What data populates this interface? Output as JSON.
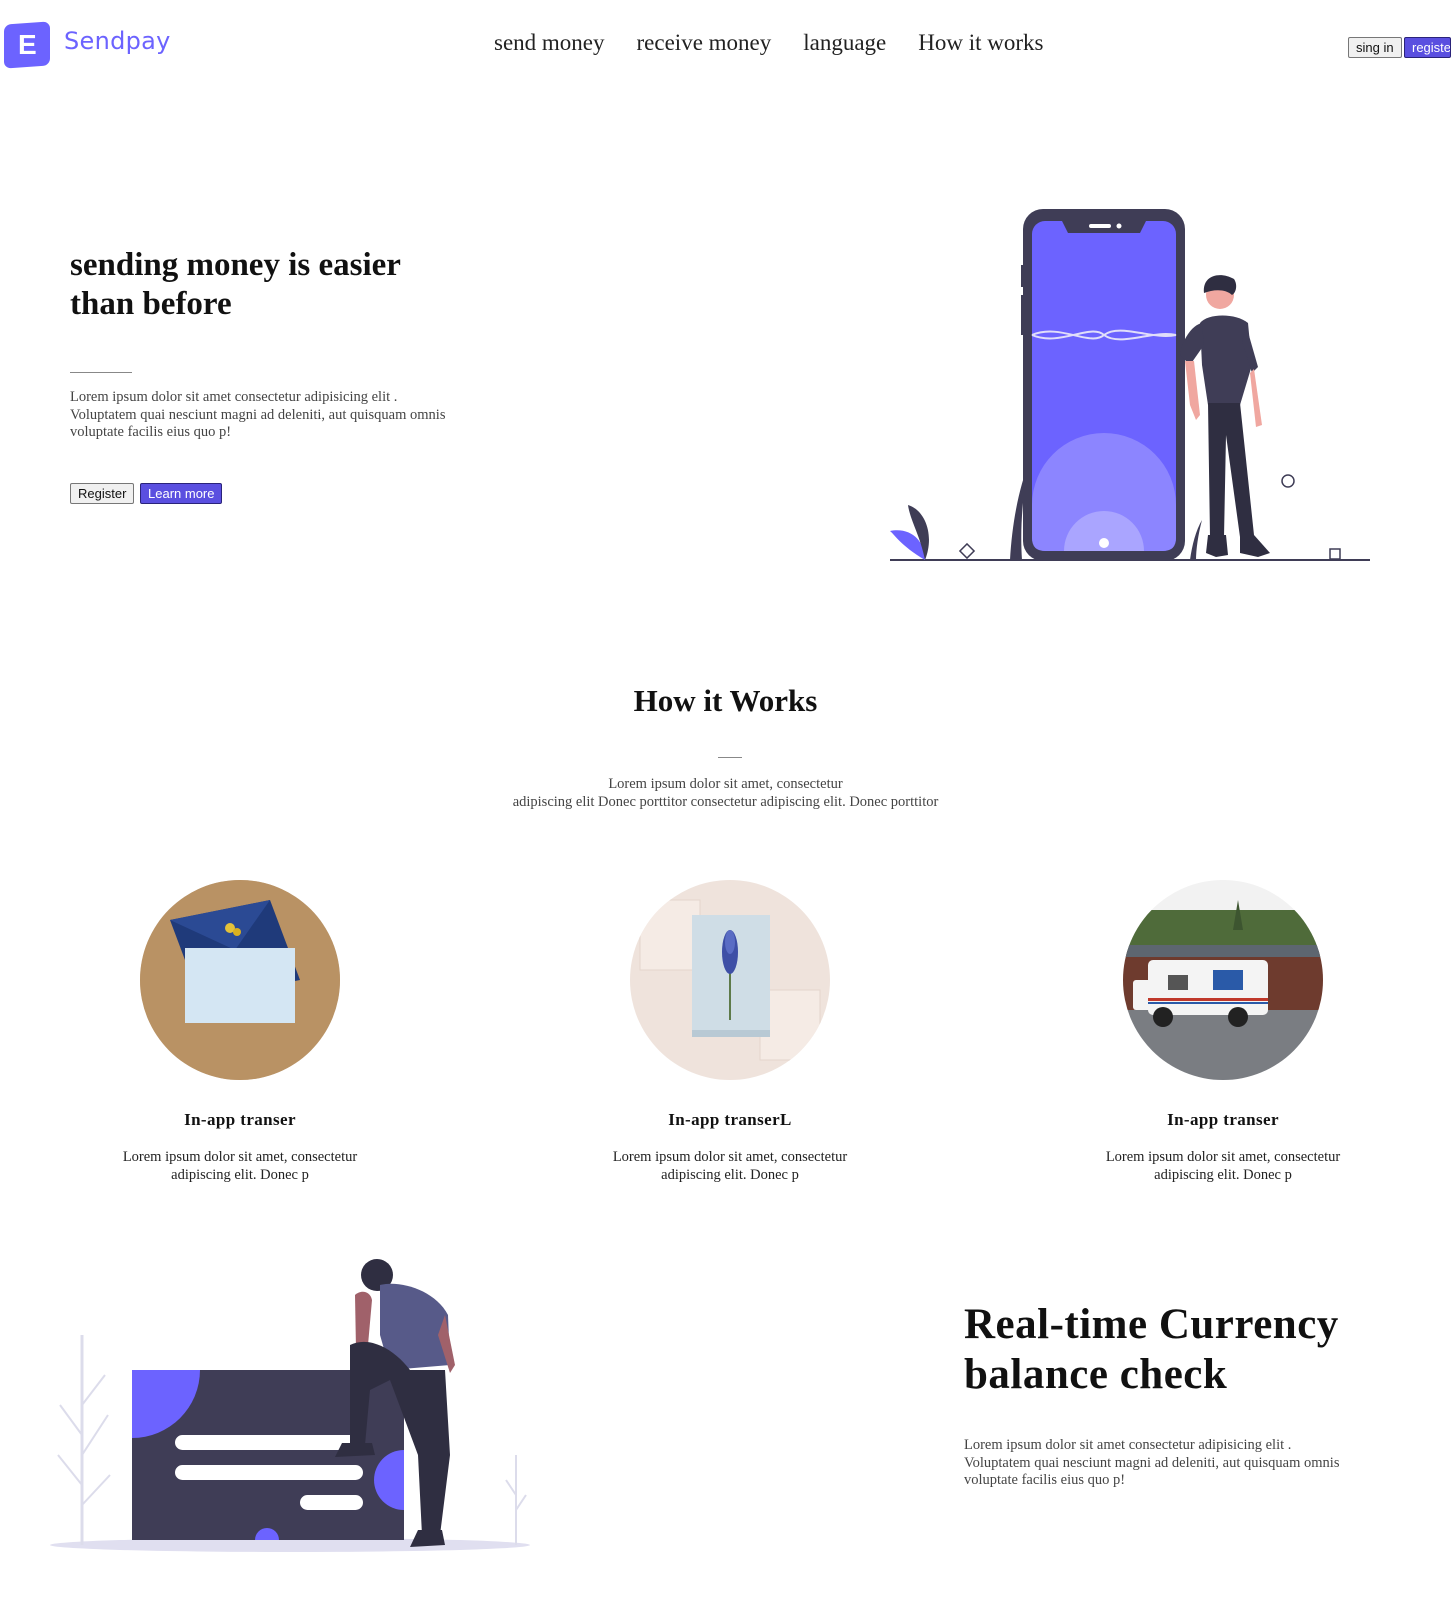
{
  "header": {
    "logo_letter": "E",
    "brand": "Sendpay",
    "nav": [
      "send money",
      "receive money",
      "language",
      "How it works"
    ],
    "sign_in_label": "sing in",
    "register_label": "register"
  },
  "hero": {
    "title": "sending money is easier than before",
    "description": "Lorem ipsum dolor sit amet consectetur adipisicing elit . Voluptatem quai nesciunt magni ad deleniti, aut quisquam omnis voluptate facilis eius quo p!",
    "register_label": "Register",
    "learn_more_label": "Learn more"
  },
  "how_it_works": {
    "title": "How it Works",
    "subtitle_line1": "Lorem ipsum dolor sit amet, consectetur",
    "subtitle_line2": "adipiscing elit Donec porttitor consectetur adipiscing elit. Donec porttitor",
    "cards": [
      {
        "title": "In-app transer",
        "text": "Lorem ipsum dolor sit amet, consectetur adipiscing elit. Donec p",
        "image": "envelope-photo"
      },
      {
        "title": "In-app transerL",
        "text": "Lorem ipsum dolor sit amet, consectetur adipiscing elit. Donec p",
        "image": "flower-card-photo"
      },
      {
        "title": "In-app transer",
        "text": "Lorem ipsum dolor sit amet, consectetur adipiscing elit. Donec p",
        "image": "mail-truck-photo"
      }
    ]
  },
  "realtime": {
    "title": "Real-time Currency balance check",
    "description": "Lorem ipsum dolor sit amet consectetur adipisicing elit . Voluptatem quai nesciunt magni ad deleniti, aut quisquam omnis voluptate facilis eius quo p!"
  },
  "colors": {
    "accent": "#6c63ff",
    "button_primary": "#5a4fe0",
    "dark_figure": "#3f3d56"
  }
}
